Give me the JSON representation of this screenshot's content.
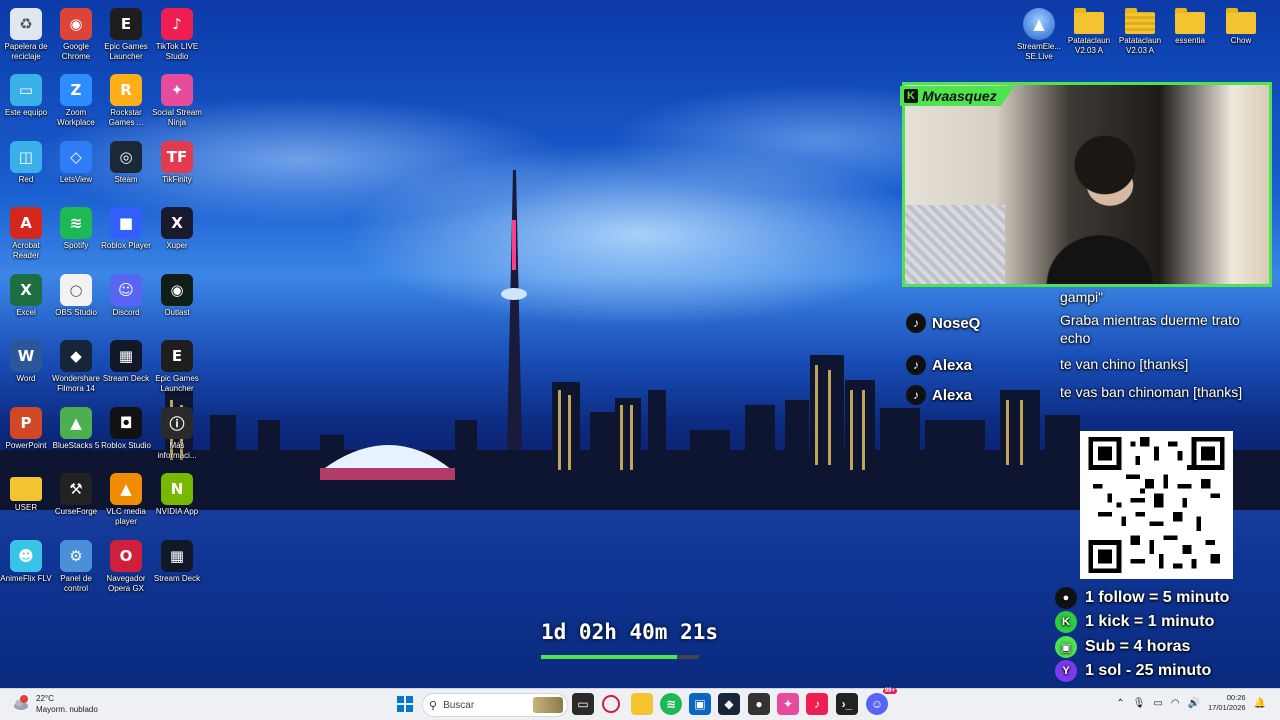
{
  "desktop_icons": [
    {
      "label": "Papelera de reciclaje",
      "icon": "recycle-bin-icon",
      "color": "#dfe7f1"
    },
    {
      "label": "Google Chrome",
      "icon": "chrome-icon",
      "color": "#db4437"
    },
    {
      "label": "Epic Games Launcher",
      "icon": "epic-games-icon",
      "color": "#1e1e1e"
    },
    {
      "label": "TikTok LIVE Studio",
      "icon": "tiktok-icon",
      "color": "#ee1d52"
    },
    {
      "label": "Este equipo",
      "icon": "monitor-icon",
      "color": "#3ab0e8"
    },
    {
      "label": "Zoom Workplace",
      "icon": "zoom-icon",
      "color": "#2d8cff"
    },
    {
      "label": "Rockstar Games ...",
      "icon": "rockstar-icon",
      "color": "#fcaf17"
    },
    {
      "label": "Social Stream Ninja",
      "icon": "social-stream-icon",
      "color": "#e74c9c"
    },
    {
      "label": "Red",
      "icon": "network-icon",
      "color": "#3ab0e8"
    },
    {
      "label": "LetsView",
      "icon": "letsview-icon",
      "color": "#2f7df6"
    },
    {
      "label": "Steam",
      "icon": "steam-icon",
      "color": "#1b2838"
    },
    {
      "label": "TikFinity",
      "icon": "tikfinity-icon",
      "color": "#e23a4f"
    },
    {
      "label": "Acrobat Reader",
      "icon": "acrobat-icon",
      "color": "#d3271b"
    },
    {
      "label": "Spotify",
      "icon": "spotify-icon",
      "color": "#1db954"
    },
    {
      "label": "Roblox Player",
      "icon": "roblox-icon",
      "color": "#335fff"
    },
    {
      "label": "Xuper",
      "icon": "xuper-icon",
      "color": "#1a1a2e"
    },
    {
      "label": "Excel",
      "icon": "excel-icon",
      "color": "#1d6f42"
    },
    {
      "label": "OBS Studio",
      "icon": "obs-icon",
      "color": "#f2f2f2"
    },
    {
      "label": "Discord",
      "icon": "discord-icon",
      "color": "#5865f2"
    },
    {
      "label": "Outlast",
      "icon": "outlast-icon",
      "color": "#0f1f18"
    },
    {
      "label": "Word",
      "icon": "word-icon",
      "color": "#2b579a"
    },
    {
      "label": "Wondershare Filmora 14",
      "icon": "filmora-icon",
      "color": "#17253a"
    },
    {
      "label": "Stream Deck",
      "icon": "stream-deck-icon",
      "color": "#111827"
    },
    {
      "label": "Epic Games Launcher",
      "icon": "epic-games-icon",
      "color": "#1e1e1e"
    },
    {
      "label": "PowerPoint",
      "icon": "powerpoint-icon",
      "color": "#d24726"
    },
    {
      "label": "BlueStacks 5",
      "icon": "bluestacks-icon",
      "color": "#4caf50"
    },
    {
      "label": "Roblox Studio",
      "icon": "roblox-studio-icon",
      "color": "#111111"
    },
    {
      "label": "Más informaci...",
      "icon": "info-icon",
      "color": "#2a2a2a"
    },
    {
      "label": "USER",
      "icon": "folder-icon",
      "color": "#f4c430"
    },
    {
      "label": "CurseForge",
      "icon": "curseforge-icon",
      "color": "#222222"
    },
    {
      "label": "VLC media player",
      "icon": "vlc-icon",
      "color": "#f18c00"
    },
    {
      "label": "NVIDIA App",
      "icon": "nvidia-icon",
      "color": "#76b900"
    },
    {
      "label": "AnimeFlix FLV",
      "icon": "animeflix-icon",
      "color": "#39c3e6"
    },
    {
      "label": "Panel de control",
      "icon": "control-panel-icon",
      "color": "#4a90d9"
    },
    {
      "label": "Navegador Opera GX",
      "icon": "opera-gx-icon",
      "color": "#cf1f3a"
    },
    {
      "label": "Stream Deck",
      "icon": "stream-deck-icon",
      "color": "#111827"
    }
  ],
  "top_right_icons": [
    {
      "label": "StreamEle... SE.Live",
      "icon": "streamelements-icon"
    },
    {
      "label": "Patataclaun V2.03 A",
      "icon": "folder-icon"
    },
    {
      "label": "Patataclaun V2.03 A",
      "icon": "folder-zip-icon"
    },
    {
      "label": "essentia",
      "icon": "folder-icon"
    },
    {
      "label": "Chow",
      "icon": "folder-icon"
    }
  ],
  "webcam": {
    "streamer_name": "Mvaasquez",
    "badge": "K",
    "accent": "#4ee44e"
  },
  "chat": [
    {
      "user": "",
      "message": "gampi\""
    },
    {
      "user": "NoseQ",
      "message": "Graba mientras duerme trato echo"
    },
    {
      "user": "Alexa",
      "message": "te van chino [thanks]"
    },
    {
      "user": "Alexa",
      "message": "te vas ban chinoman [thanks]"
    }
  ],
  "rules": [
    {
      "icon": "follow-icon",
      "text": "1 follow = 5 minuto",
      "color": "#111111"
    },
    {
      "icon": "kick-icon",
      "text": "1 kick = 1 minuto",
      "color": "#2ecc40"
    },
    {
      "icon": "gift-icon",
      "text": "Sub = 4 horas",
      "color": "#4ee44e"
    },
    {
      "icon": "sol-icon",
      "text": "1 sol - 25 minuto",
      "color": "#7c3aed",
      "badge": "Y"
    }
  ],
  "timer": {
    "text": "1d 02h 40m 21s",
    "progress": 0.86
  },
  "taskbar": {
    "weather": {
      "temp": "22°C",
      "desc": "Mayorm. nublado",
      "alert_count": "1"
    },
    "search_placeholder": "Buscar",
    "notification_badge": "99+",
    "clock_time": "00:26",
    "clock_date": "17/01/2026"
  }
}
